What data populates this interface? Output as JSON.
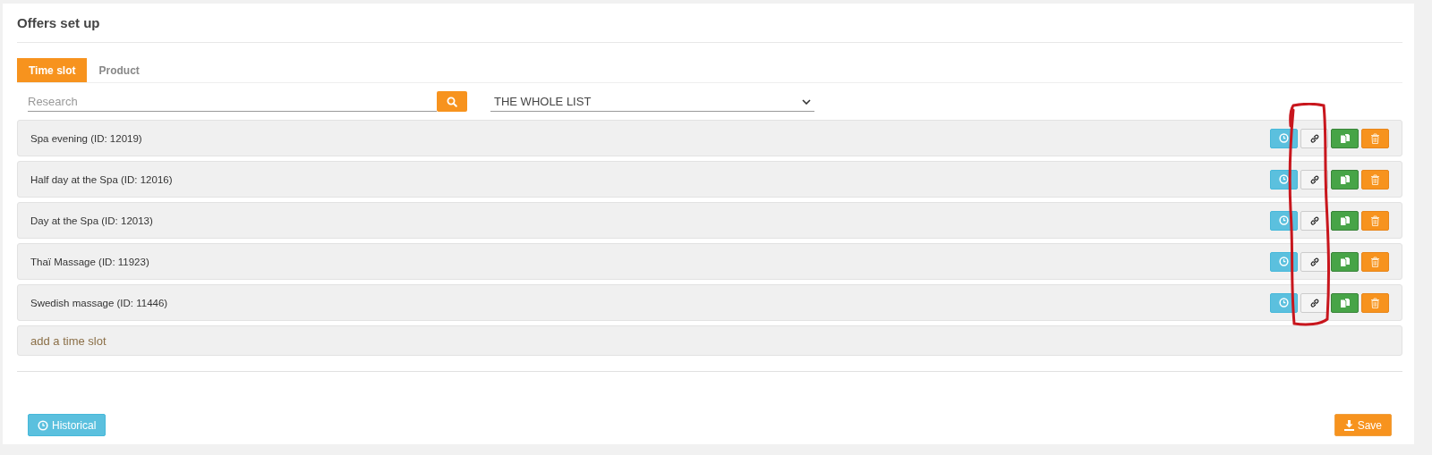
{
  "page": {
    "title": "Offers set up"
  },
  "tabs": [
    {
      "label": "Time slot",
      "selected": true
    },
    {
      "label": "Product",
      "selected": false
    }
  ],
  "search": {
    "placeholder": "Research"
  },
  "filter": {
    "value": "THE WHOLE LIST"
  },
  "time_slots": [
    {
      "name": "Spa evening (ID: 12019)"
    },
    {
      "name": "Half day at the Spa (ID: 12016)"
    },
    {
      "name": "Day at the Spa (ID: 12013)"
    },
    {
      "name": "Thaï Massage (ID: 11923)"
    },
    {
      "name": "Swedish massage (ID: 11446)"
    }
  ],
  "add_link": "add a time slot",
  "footer": {
    "historical": "Historical",
    "save": "Save"
  }
}
